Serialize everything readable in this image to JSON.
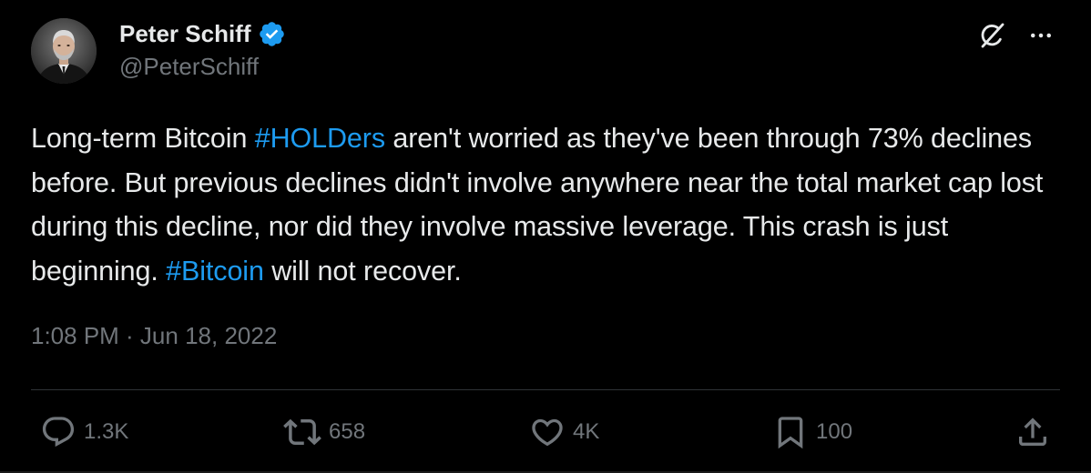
{
  "author": {
    "display_name": "Peter Schiff",
    "handle": "@PeterSchiff",
    "verified": true,
    "verified_color": "#1d9bf0"
  },
  "icons": {
    "grok": "grok-icon",
    "more": "more-icon",
    "verified": "verified-badge-icon",
    "reply": "reply-icon",
    "repost": "repost-icon",
    "like": "like-icon",
    "bookmark": "bookmark-icon",
    "share": "share-icon"
  },
  "tweet": {
    "segments": [
      {
        "text": "Long-term Bitcoin ",
        "type": "text"
      },
      {
        "text": "#HOLDers",
        "type": "hashtag"
      },
      {
        "text": " aren't worried as they've been through 73% declines before. But previous declines didn't involve anywhere near the total market cap lost during this decline, nor did they involve massive leverage. This crash is just beginning. ",
        "type": "text"
      },
      {
        "text": "#Bitcoin",
        "type": "hashtag"
      },
      {
        "text": " will not recover.",
        "type": "text"
      }
    ],
    "timestamp": "1:08 PM · Jun 18, 2022"
  },
  "stats": {
    "replies": "1.3K",
    "reposts": "658",
    "likes": "4K",
    "bookmarks": "100"
  },
  "colors": {
    "background": "#000000",
    "text_primary": "#e7e9ea",
    "text_secondary": "#71767b",
    "link": "#1d9bf0",
    "divider": "#2f3336"
  }
}
